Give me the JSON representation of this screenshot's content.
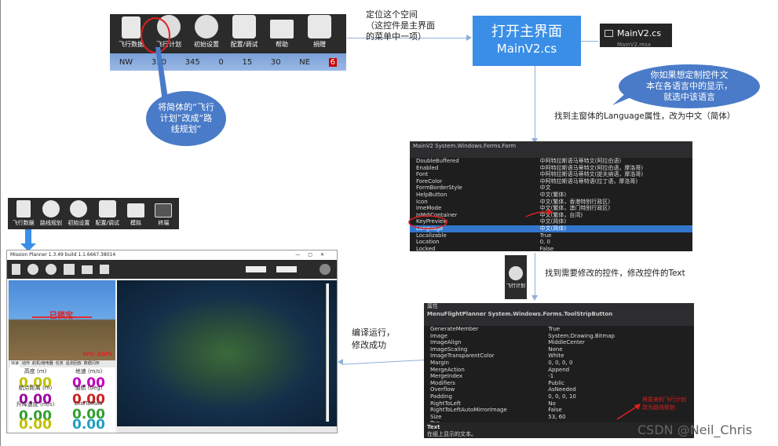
{
  "top_toolbar": {
    "items": [
      "飞行数据",
      "飞行计划",
      "初始设置",
      "配置/调试",
      "帮助",
      "捐赠"
    ],
    "hud_ticks": [
      "NW",
      "330",
      "345",
      "0",
      "15",
      "30",
      "NE",
      "6"
    ]
  },
  "note_locate": "定位这个空间\n（这控件是主界面\n的菜单中一项）",
  "open_main_box": {
    "line1": "打开主界面",
    "line2": "MainV2.cs"
  },
  "solution_file": {
    "name": "MainV2.cs",
    "next": "MainV2.resx"
  },
  "bubble_rename": "将简体的“飞行\n计划”改成“路\n线规划”",
  "bubble_language": "你如果想定制控件文\n本在各语言中的显示，\n就选中该语言",
  "note_language": "找到主窗体的Language属性，改为中文（简体）",
  "props_form": {
    "title": "MainV2 System.Windows.Forms.Form",
    "rows": [
      [
        "DoubleBuffered",
        "中阿特拉斯语马蒂特文(阿拉伯语)"
      ],
      [
        "Enabled",
        "中阿特拉斯语马蒂特文(阿拉伯语，摩洛哥)"
      ],
      [
        "Font",
        "中阿特拉斯语马蒂特文(提夫纳语，摩洛哥)"
      ],
      [
        "ForeColor",
        "中阿特拉斯语马蒂特语(拉丁语，摩洛哥)"
      ],
      [
        "FormBorderStyle",
        "中文"
      ],
      [
        "HelpButton",
        "中文(繁体)"
      ],
      [
        "Icon",
        "中文(繁体，香港特别行政区)"
      ],
      [
        "ImeMode",
        "中文(繁体，澳门特别行政区)"
      ],
      [
        "IsMdiContainer",
        "中文(繁体，台湾)"
      ],
      [
        "KeyPreview",
        "中文(简体)"
      ],
      [
        "Language",
        "中文(简体)"
      ],
      [
        "Localizable",
        "True"
      ],
      [
        "Location",
        "0, 0"
      ],
      [
        "Locked",
        "False"
      ],
      [
        "MainMenuStrip",
        "MainMenu"
      ]
    ]
  },
  "flight_plan_icon_label": "飞行计划",
  "note_modify": "找到需要修改的控件，修改控件的Text",
  "props_button": {
    "section": "属性",
    "title": "MenuFlightPlanner System.Windows.Forms.ToolStripButton",
    "rows": [
      [
        "GenerateMember",
        "True"
      ],
      [
        "Image",
        "System.Drawing.Bitmap"
      ],
      [
        "ImageAlign",
        "MiddleCenter"
      ],
      [
        "ImageScaling",
        "None"
      ],
      [
        "ImageTransparentColor",
        "White"
      ],
      [
        "Margin",
        "0, 0, 0, 0"
      ],
      [
        "MergeAction",
        "Append"
      ],
      [
        "MergeIndex",
        "-1"
      ],
      [
        "Modifiers",
        "Public"
      ],
      [
        "Overflow",
        "AsNeeded"
      ],
      [
        "Padding",
        "0, 0, 0, 10"
      ],
      [
        "RightToLeft",
        "No"
      ],
      [
        "RightToLeftAutoMirrorImage",
        "False"
      ],
      [
        "Size",
        "53, 60"
      ],
      [
        "Tag",
        ""
      ],
      [
        "Text",
        "飞行计划"
      ]
    ],
    "footer_title": "Text",
    "footer_desc": "在组上显示的文本。",
    "annotation": "将原来的飞行计划\n改为路线规划"
  },
  "note_compile": "编译运行，\n修改成功",
  "new_toolbar": {
    "items": [
      "飞行数据",
      "路线规划",
      "初始设置",
      "配置/调试",
      "模拟",
      "终端"
    ]
  },
  "app": {
    "title": "Mission Planner 1.3.49 build 1.1.6667.38014",
    "hud_status": "已锁定",
    "hud_gps": "GPS: 无GPS",
    "tabs": [
      "快速",
      "动作",
      "舵机/继电器",
      "任务",
      "遥测回放",
      "数据闪存"
    ],
    "telemetry": [
      {
        "label": "高度 (m)",
        "value": "0.00",
        "color": "#c0c000"
      },
      {
        "label": "地速 (m/s)",
        "value": "0.00",
        "color": "#c000c0"
      },
      {
        "label": "航点距离 (m)",
        "value": "0.00",
        "color": "#a000a0"
      },
      {
        "label": "偏航 (deg)",
        "value": "0.00",
        "color": "#d02020"
      },
      {
        "label": "升降速度 (m/s)",
        "value": "0.00",
        "color": "#30a030"
      },
      {
        "label": "DistToMAV",
        "value": "0.00",
        "color": "#30a030"
      },
      {
        "label": "",
        "value": "0.00",
        "color": "#c0c000"
      },
      {
        "label": "",
        "value": "0.00",
        "color": "#20a0c0"
      }
    ]
  },
  "watermark": "CSDN @Neil_Chris",
  "colors": {
    "accent": "#3a8ee6",
    "bubble": "#4a7bc8",
    "arrow": "#8fb0d8",
    "annotation_red": "#e02020"
  }
}
